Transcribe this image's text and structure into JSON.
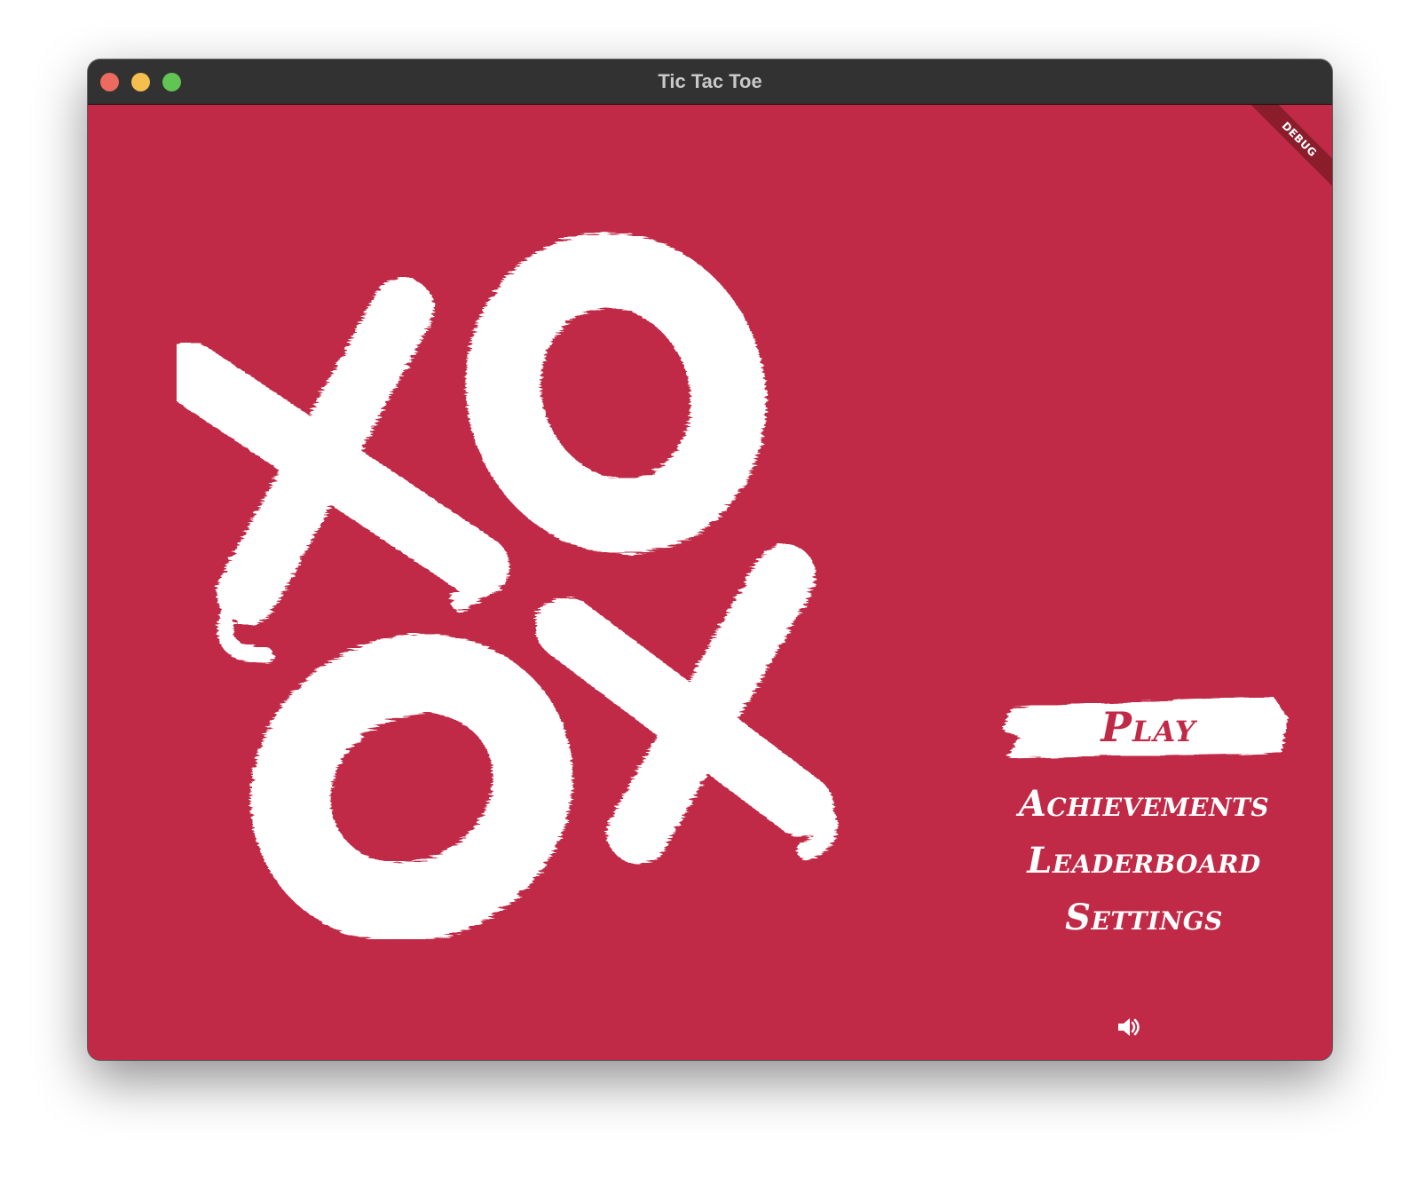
{
  "window": {
    "title": "Tic Tac Toe"
  },
  "debug_banner": "DEBUG",
  "menu": {
    "play": "Play",
    "achievements": "Achievements",
    "leaderboard": "Leaderboard",
    "settings": "Settings"
  },
  "icons": {
    "sound": "speaker-icon",
    "logo": "tic-tac-toe-logo"
  },
  "colors": {
    "background": "#c02a47",
    "titlebar": "#323232",
    "foreground": "#ffffff"
  }
}
